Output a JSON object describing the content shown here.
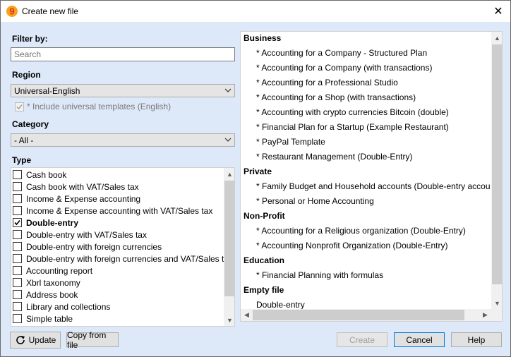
{
  "window": {
    "title": "Create new file",
    "close_glyph": "✕",
    "logo_icon": "banana-logo-icon",
    "logo_glyph": "9"
  },
  "filter": {
    "label": "Filter by:",
    "search_placeholder": "Search"
  },
  "region": {
    "label": "Region",
    "selected": "Universal-English",
    "include_universal_label": "* Include universal templates (English)",
    "include_universal_checked": true
  },
  "category": {
    "label": "Category",
    "selected": "- All -"
  },
  "type": {
    "label": "Type",
    "items": [
      {
        "label": "Cash book",
        "checked": false
      },
      {
        "label": "Cash book with VAT/Sales tax",
        "checked": false
      },
      {
        "label": "Income & Expense accounting",
        "checked": false
      },
      {
        "label": "Income & Expense accounting with VAT/Sales tax",
        "checked": false
      },
      {
        "label": "Double-entry",
        "checked": true
      },
      {
        "label": "Double-entry with VAT/Sales tax",
        "checked": false
      },
      {
        "label": "Double-entry with foreign currencies",
        "checked": false
      },
      {
        "label": "Double-entry with foreign currencies and VAT/Sales t",
        "checked": false
      },
      {
        "label": "Accounting report",
        "checked": false
      },
      {
        "label": "Xbrl taxonomy",
        "checked": false
      },
      {
        "label": "Address book",
        "checked": false
      },
      {
        "label": "Library and collections",
        "checked": false
      },
      {
        "label": "Simple table",
        "checked": false
      }
    ]
  },
  "templates": {
    "rows": [
      {
        "kind": "group",
        "text": "Business"
      },
      {
        "kind": "item",
        "text": "* Accounting for a Company - Structured Plan"
      },
      {
        "kind": "item",
        "text": "* Accounting for a Company (with transactions)"
      },
      {
        "kind": "item",
        "text": "* Accounting for a Professional Studio"
      },
      {
        "kind": "item",
        "text": "* Accounting for a Shop (with transactions)"
      },
      {
        "kind": "item",
        "text": "* Accounting with crypto currencies Bitcoin (double)"
      },
      {
        "kind": "item",
        "text": "* Financial Plan for a Startup (Example Restaurant)"
      },
      {
        "kind": "item",
        "text": "* PayPal Template"
      },
      {
        "kind": "item",
        "text": "* Restaurant Management (Double-Entry)"
      },
      {
        "kind": "group",
        "text": "Private"
      },
      {
        "kind": "item",
        "text": "* Family Budget and Household accounts (Double-entry accou"
      },
      {
        "kind": "item",
        "text": "* Personal or Home Accounting"
      },
      {
        "kind": "group",
        "text": "Non-Profit"
      },
      {
        "kind": "item",
        "text": "* Accounting for a Religious organization (Double-Entry)"
      },
      {
        "kind": "item",
        "text": "* Accounting Nonprofit Organization (Double-Entry)"
      },
      {
        "kind": "group",
        "text": "Education"
      },
      {
        "kind": "item",
        "text": "* Financial Planning with formulas"
      },
      {
        "kind": "group",
        "text": "Empty file"
      },
      {
        "kind": "subitem",
        "text": "Double-entry"
      }
    ]
  },
  "buttons": {
    "update": "Update",
    "copy_from_file": "Copy from file",
    "create": "Create",
    "cancel": "Cancel",
    "help": "Help"
  },
  "colors": {
    "client_bg": "#dde8f8",
    "logo_red": "#e0302a",
    "logo_orange": "#f7a21b",
    "focus_blue": "#0078d7"
  },
  "icons": {
    "update": "refresh-icon",
    "combo_arrow": "chevron-down-icon",
    "scroll_up": "scroll-up-arrow-icon",
    "scroll_down": "scroll-down-arrow-icon",
    "scroll_left": "scroll-left-arrow-icon",
    "scroll_right": "scroll-right-arrow-icon"
  }
}
